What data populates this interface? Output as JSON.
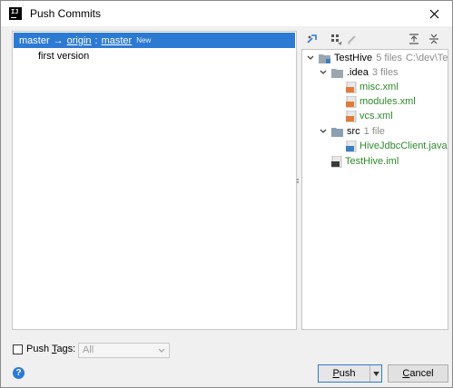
{
  "window": {
    "title": "Push Commits",
    "app_icon_text": "IJ"
  },
  "commits_panel": {
    "branch": {
      "local": "master",
      "arrow": "→",
      "remote": "origin",
      "separator": ":",
      "remote_branch": "master",
      "badge": "New"
    },
    "commits": [
      {
        "message": "first version"
      }
    ]
  },
  "toolbar": {
    "icons": [
      "pin-icon",
      "group-icon",
      "edit-icon",
      "expand-all-icon",
      "collapse-all-icon"
    ]
  },
  "file_tree": {
    "root": {
      "name": "TestHive",
      "count": "5 files",
      "path": "C:\\dev\\Tes"
    },
    "idea_folder": {
      "name": ".idea",
      "count": "3 files"
    },
    "idea_files": [
      "misc.xml",
      "modules.xml",
      "vcs.xml"
    ],
    "src_folder": {
      "name": "src",
      "count": "1 file"
    },
    "src_files": [
      "HiveJdbcClient.java"
    ],
    "root_files": [
      "TestHive.iml"
    ]
  },
  "bottom": {
    "push_tags_label_pre": "Push ",
    "push_tags_mnemonic": "T",
    "push_tags_label_post": "ags:",
    "push_tags_checked": false,
    "tags_select_value": "All"
  },
  "buttons": {
    "push_mnemonic": "P",
    "push_rest": "ush",
    "cancel_mnemonic": "C",
    "cancel_rest": "ancel",
    "help": "?"
  },
  "colors": {
    "selection": "#2d7ad3",
    "file_added": "#2d8a2d",
    "accent": "#2b7ad7"
  }
}
